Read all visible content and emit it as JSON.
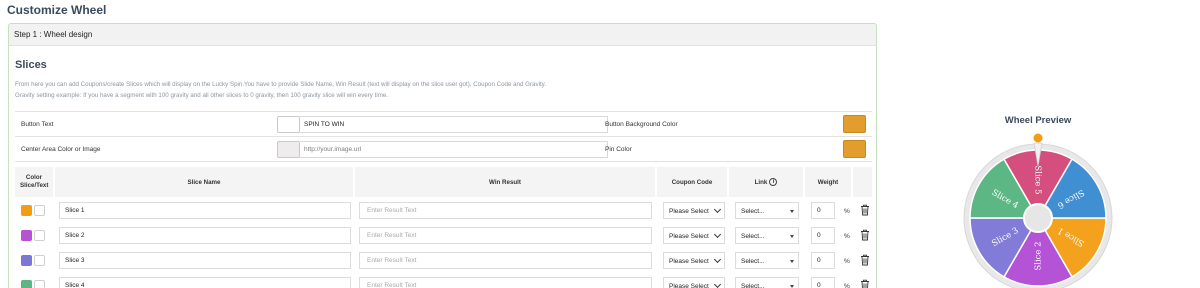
{
  "page": {
    "title": "Customize Wheel"
  },
  "step": {
    "title": "Step 1 : Wheel design"
  },
  "slices_section": {
    "title": "Slices",
    "description_line1": "From here you can add Coupons/create Slices which will display on the Lucky Spin.You have to provide Slide Name, Win Result (text will display on the slice user got), Coupon Code and Gravity.",
    "description_line2": "Gravity setting example: If you have a segment with 100 gravity and all other slices to 0 gravity, then 100 gravity slice will win every time."
  },
  "options": {
    "button_text": {
      "label": "Button Text",
      "value": "SPIN TO WIN",
      "swatch_color": "#ffffff"
    },
    "center_area": {
      "label": "Center Area Color or Image",
      "placeholder": "http://your.image.url",
      "swatch_color": "#eeeced"
    },
    "button_bg": {
      "label": "Button Background Color",
      "color": "#e29d2c"
    },
    "pin": {
      "label": "Pin Color",
      "color": "#e29d2c"
    }
  },
  "table": {
    "headers": {
      "color": "Color Slice/Text",
      "name": "Slice Name",
      "result": "Win Result",
      "coupon": "Coupon Code",
      "link": "Link",
      "weight": "Weight"
    },
    "rows": [
      {
        "slice_color": "#f29d13",
        "name": "Slice 1",
        "result_placeholder": "Enter Result Text",
        "coupon": "Please Select",
        "link": "Select...",
        "weight": "0"
      },
      {
        "slice_color": "#b752d6",
        "name": "Slice 2",
        "result_placeholder": "Enter Result Text",
        "coupon": "Please Select",
        "link": "Select...",
        "weight": "0"
      },
      {
        "slice_color": "#7b76d8",
        "name": "Slice 3",
        "result_placeholder": "Enter Result Text",
        "coupon": "Please Select",
        "link": "Select...",
        "weight": "0"
      },
      {
        "slice_color": "#5bb585",
        "name": "Slice 4",
        "result_placeholder": "Enter Result Text",
        "coupon": "Please Select",
        "link": "Select...",
        "weight": "0"
      }
    ],
    "percent_symbol": "%"
  },
  "preview": {
    "title": "Wheel Preview",
    "slices": [
      {
        "label": "Slice 1",
        "color": "#f4a11d"
      },
      {
        "label": "Slice 2",
        "color": "#b453d5"
      },
      {
        "label": "Slice 3",
        "color": "#837bd8"
      },
      {
        "label": "Slice 4",
        "color": "#5db784"
      },
      {
        "label": "Slice 5",
        "color": "#d54f7e"
      },
      {
        "label": "Slice 6",
        "color": "#3f8fd2"
      }
    ],
    "rim_color": "#e8e8e8",
    "pin_color": "#f29d13",
    "hub_color": "#e6e6e6"
  }
}
